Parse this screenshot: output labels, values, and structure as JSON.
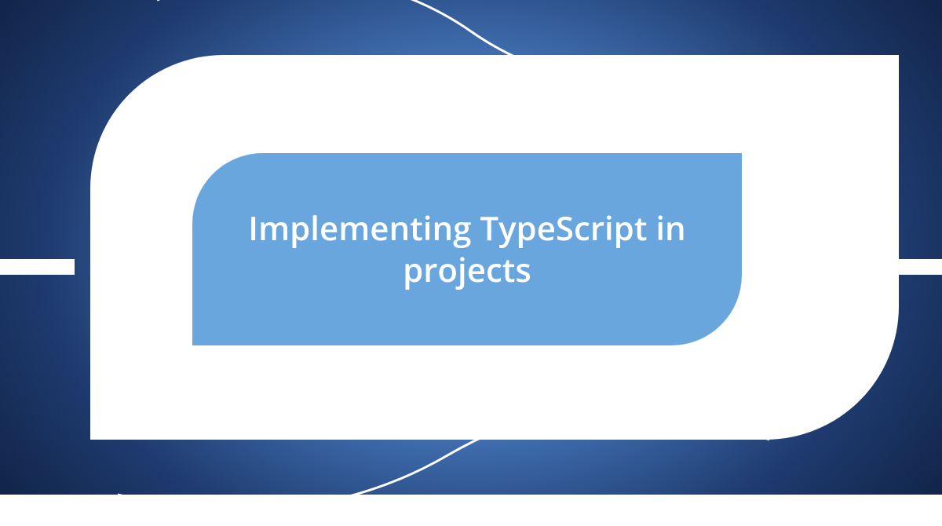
{
  "card": {
    "title": "Implementing TypeScript in projects"
  },
  "colors": {
    "inner_bg": "#6aa6de",
    "outer_bg": "#ffffff",
    "text": "#ffffff"
  }
}
